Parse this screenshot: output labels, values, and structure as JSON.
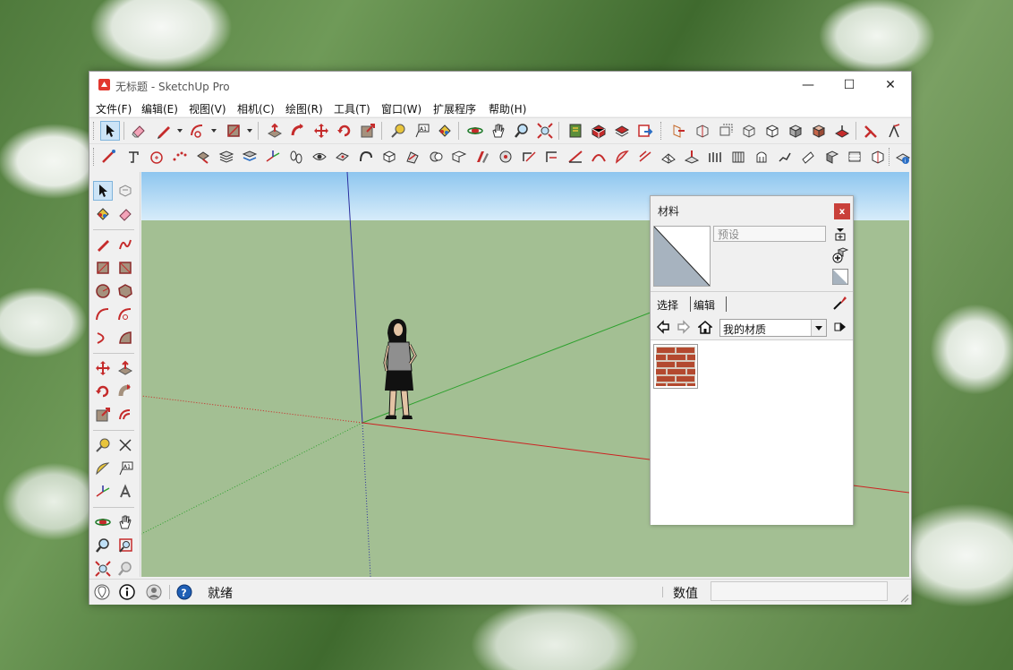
{
  "window": {
    "title": "无标题 - SketchUp Pro",
    "controls": {
      "minimize": "—",
      "maximize": "☐",
      "close": "✕"
    }
  },
  "menu": [
    "文件(F)",
    "编辑(E)",
    "视图(V)",
    "相机(C)",
    "绘图(R)",
    "工具(T)",
    "窗口(W)",
    "扩展程序",
    "帮助(H)"
  ],
  "materials_panel": {
    "title": "材料",
    "close_label": "x",
    "name_field_value": "预设",
    "tabs": [
      "选择",
      "编辑"
    ],
    "collection": "我的材质",
    "swatches": [
      {
        "icon": "brick-material-icon"
      }
    ]
  },
  "status": {
    "text": "就绪",
    "value_label": "数值",
    "value": ""
  },
  "colors": {
    "sky": "#a9d4f2",
    "ground": "#a3bf93",
    "axis_red": "#cc2222",
    "axis_green": "#2ea12e",
    "axis_blue": "#2b2f9e",
    "accent_active": "#cce4f7"
  }
}
